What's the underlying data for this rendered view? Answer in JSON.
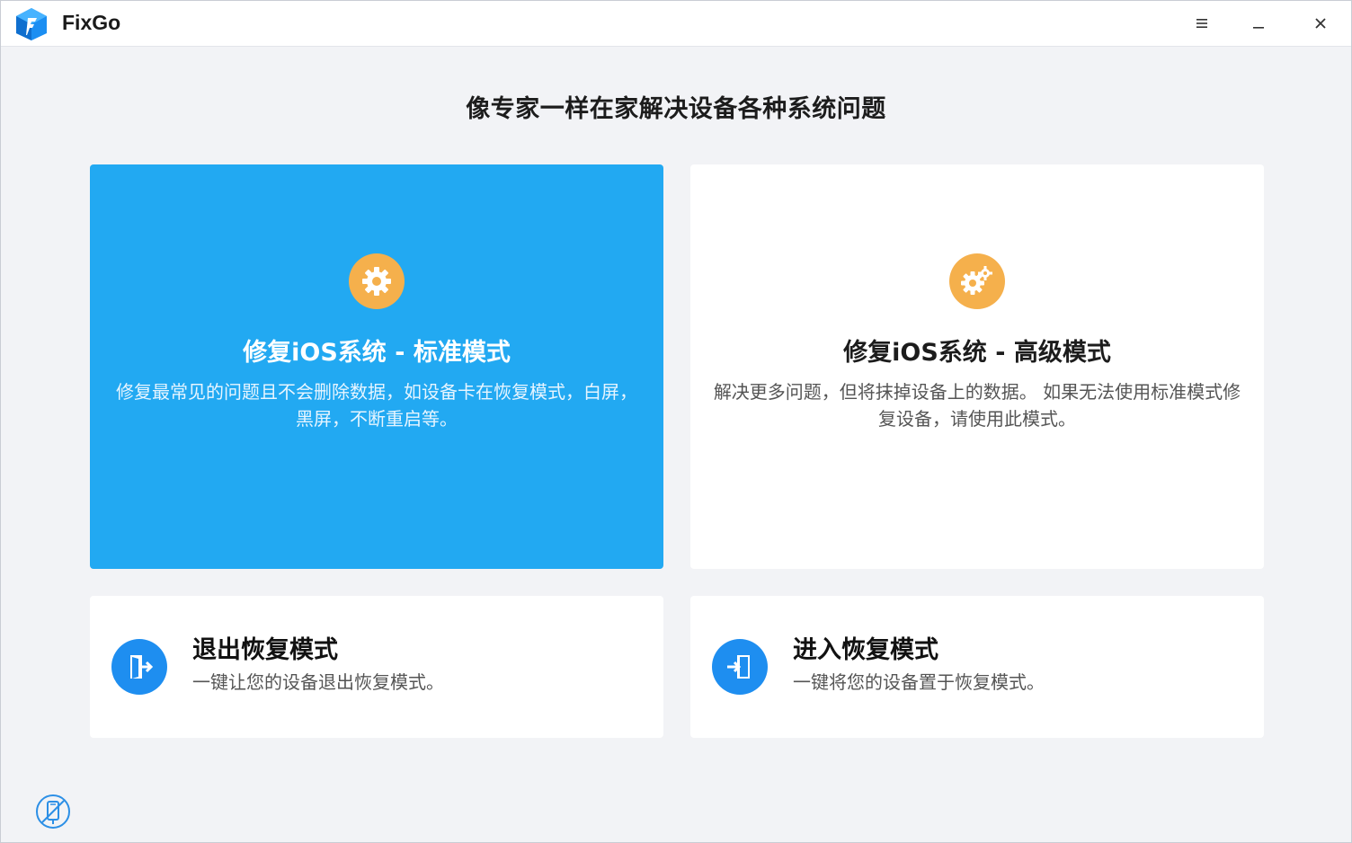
{
  "app": {
    "name": "FixGo"
  },
  "titlebar": {
    "menu_icon": "hamburger-menu-icon",
    "minimize_icon": "minimize-icon",
    "close_icon": "close-icon"
  },
  "headline": "像专家一样在家解决设备各种系统问题",
  "cards": {
    "standard": {
      "title": "修复iOS系统 - 标准模式",
      "description": "修复最常见的问题且不会删除数据，如设备卡在恢复模式，白屏，黑屏，不断重启等。",
      "icon": "gear-icon"
    },
    "advanced": {
      "title": "修复iOS系统 - 高级模式",
      "description": "解决更多问题，但将抹掉设备上的数据。 如果无法使用标准模式修复设备，请使用此模式。",
      "icon": "gears-icon"
    },
    "exit_recovery": {
      "title": "退出恢复模式",
      "description": "一键让您的设备退出恢复模式。",
      "icon": "exit-door-icon"
    },
    "enter_recovery": {
      "title": "进入恢复模式",
      "description": "一键将您的设备置于恢复模式。",
      "icon": "enter-door-icon"
    }
  },
  "footer": {
    "device_status_icon": "device-disconnected-icon"
  },
  "colors": {
    "accent_blue": "#22a9f2",
    "icon_orange": "#f5b04c",
    "icon_blue": "#1e8ef0",
    "background": "#f2f3f6"
  }
}
